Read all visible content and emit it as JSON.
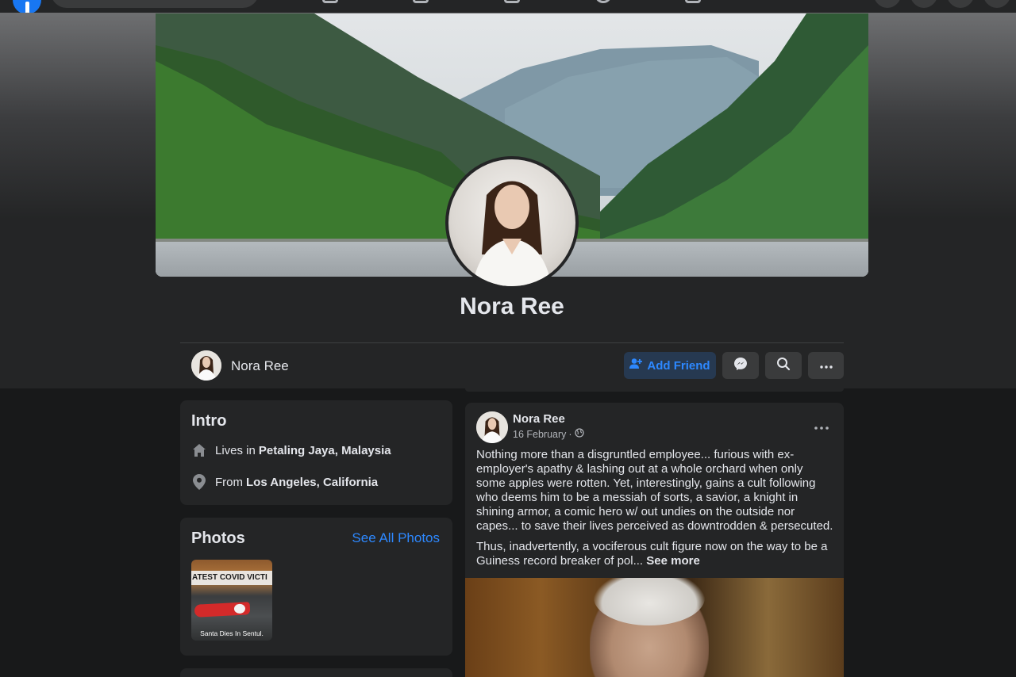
{
  "profile": {
    "name": "Nora Ree"
  },
  "sticky_bar": {
    "name": "Nora Ree",
    "add_friend_label": "Add Friend"
  },
  "intro": {
    "title": "Intro",
    "lives_prefix": "Lives in",
    "lives_value": "Petaling Jaya, Malaysia",
    "from_prefix": "From",
    "from_value": "Los Angeles, California"
  },
  "photos": {
    "title": "Photos",
    "see_all": "See All Photos",
    "thumb_banner": "ATEST COVID VICTI",
    "thumb_caption": "Santa Dies In Sentul."
  },
  "post": {
    "author": "Nora Ree",
    "date": "16 February",
    "separator": "·",
    "paragraph1": "Nothing more than a disgruntled employee... furious with ex-employer's apathy & lashing out at a whole orchard when only some apples were rotten. Yet, interestingly, gains a cult following who deems him to be a messiah of sorts, a savior, a knight in shining armor, a comic hero w/ out undies on the outside nor capes... to save their lives perceived as downtrodden & persecuted.",
    "paragraph2": "Thus, inadvertently, a vociferous cult figure now on the way to be a Guiness record breaker of pol...",
    "see_more": "See more"
  },
  "colors": {
    "accent": "#2d88ff",
    "card_bg": "#242526",
    "page_bg": "#18191a",
    "facebook_blue": "#1877f2"
  },
  "icons": {
    "home": "home-icon",
    "location": "location-pin-icon",
    "add_friend": "add-friend-icon",
    "messenger": "messenger-icon",
    "search": "search-icon",
    "more": "more-dots-icon",
    "globe": "globe-icon"
  }
}
